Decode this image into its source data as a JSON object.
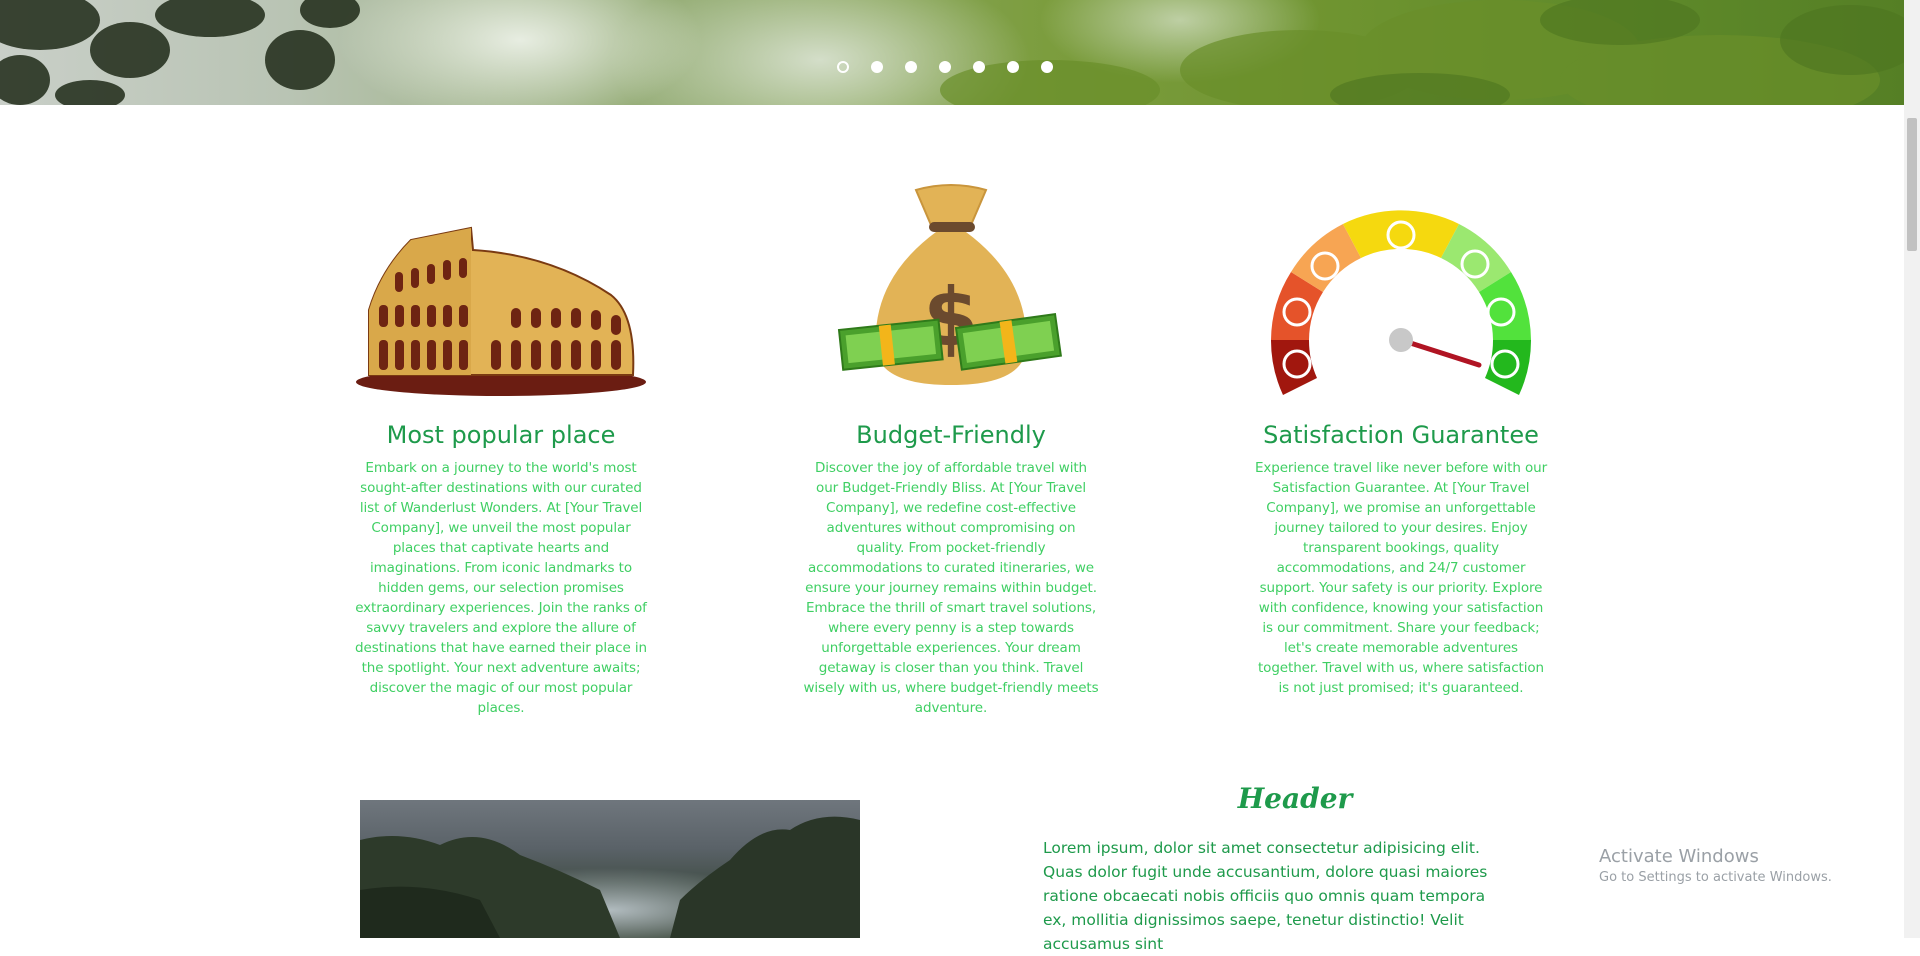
{
  "hero": {
    "slide_count": 7,
    "active_slide": 1
  },
  "features": [
    {
      "title": "Most popular place",
      "icon": "colosseum-icon",
      "text": "Embark on a journey to the world's most sought-after destinations with our curated list of Wanderlust Wonders. At [Your Travel Company], we unveil the most popular places that captivate hearts and imaginations. From iconic landmarks to hidden gems, our selection promises extraordinary experiences. Join the ranks of savvy travelers and explore the allure of destinations that have earned their place in the spotlight. Your next adventure awaits; discover the magic of our most popular places."
    },
    {
      "title": "Budget-Friendly",
      "icon": "money-bag-icon",
      "text": "Discover the joy of affordable travel with our Budget-Friendly Bliss. At [Your Travel Company], we redefine cost-effective adventures without compromising on quality. From pocket-friendly accommodations to curated itineraries, we ensure your journey remains within budget. Embrace the thrill of smart travel solutions, where every penny is a step towards unforgettable experiences. Your dream getaway is closer than you think. Travel wisely with us, where budget-friendly meets adventure."
    },
    {
      "title": "Satisfaction Guarantee",
      "icon": "satisfaction-gauge-icon",
      "text": "Experience travel like never before with our Satisfaction Guarantee. At [Your Travel Company], we promise an unforgettable journey tailored to your desires. Enjoy transparent bookings, quality accommodations, and 24/7 customer support. Your safety is our priority. Explore with confidence, knowing your satisfaction is our commitment. Share your feedback; let's create memorable adventures together. Travel with us, where satisfaction is not just promised; it's guaranteed."
    }
  ],
  "section": {
    "header": "Header",
    "body": "Lorem ipsum, dolor sit amet consectetur adipisicing elit. Quas dolor fugit unde accusantium, dolore quasi maiores ratione obcaecati nobis officiis quo omnis quam tempora ex, mollitia dignissimos saepe, tenetur distinctio! Velit accusamus sint"
  },
  "watermark": {
    "title": "Activate Windows",
    "subtitle": "Go to Settings to activate Windows."
  },
  "colors": {
    "heading_green": "#1e9a4b",
    "body_green": "#3fcf63"
  }
}
